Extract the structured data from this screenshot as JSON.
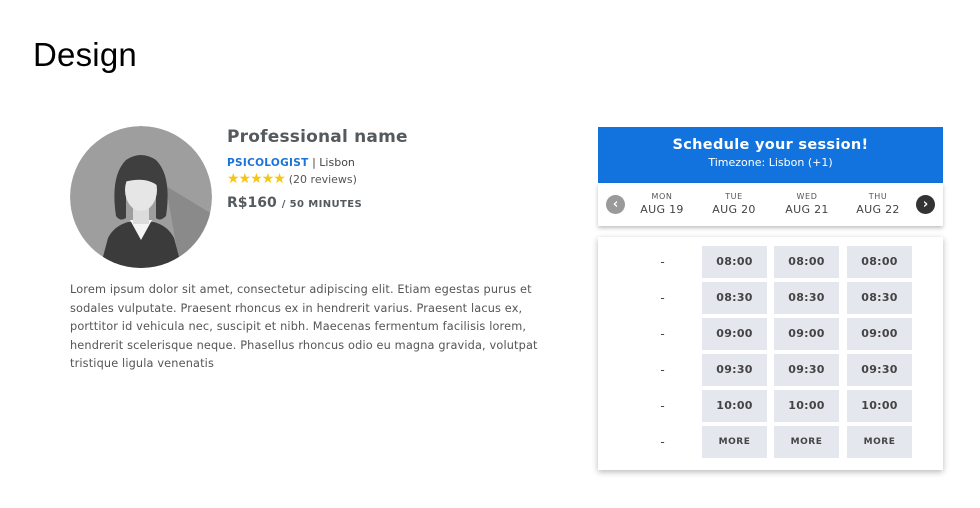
{
  "page": {
    "title": "Design"
  },
  "profile": {
    "name": "Professional name",
    "role": "PSICOLOGIST",
    "separator": " | ",
    "location": "Lisbon",
    "stars": "★★★★★",
    "rating": 5,
    "reviews": "(20 reviews)",
    "price": "R$160",
    "price_unit": "/ 50 MINUTES",
    "bio": "Lorem ipsum dolor sit amet, consectetur adipiscing elit. Etiam egestas purus et sodales vulputate. Praesent rhoncus ex in hendrerit varius. Praesent lacus ex, porttitor id vehicula nec, suscipit et nibh. Maecenas fermentum facilisis lorem, hendrerit scelerisque neque. Phasellus rhoncus odio eu magna gravida, volutpat tristique ligula venenatis"
  },
  "scheduler": {
    "title": "Schedule your session!",
    "timezone": "Timezone: Lisbon (+1)",
    "prev_icon": "chevron-left-icon",
    "next_icon": "chevron-right-icon",
    "days": [
      {
        "name": "MON",
        "date": "AUG 19"
      },
      {
        "name": "TUE",
        "date": "AUG 20"
      },
      {
        "name": "WED",
        "date": "AUG 21"
      },
      {
        "name": "THU",
        "date": "AUG 22"
      }
    ],
    "dash": "-",
    "rows": [
      [
        "08:00",
        "08:00",
        "08:00"
      ],
      [
        "08:30",
        "08:30",
        "08:30"
      ],
      [
        "09:00",
        "09:00",
        "09:00"
      ],
      [
        "09:30",
        "09:30",
        "09:30"
      ],
      [
        "10:00",
        "10:00",
        "10:00"
      ],
      [
        "MORE",
        "MORE",
        "MORE"
      ]
    ]
  },
  "colors": {
    "accent": "#1273de",
    "slot_bg": "#e5e7ee",
    "star": "#f5c518"
  }
}
